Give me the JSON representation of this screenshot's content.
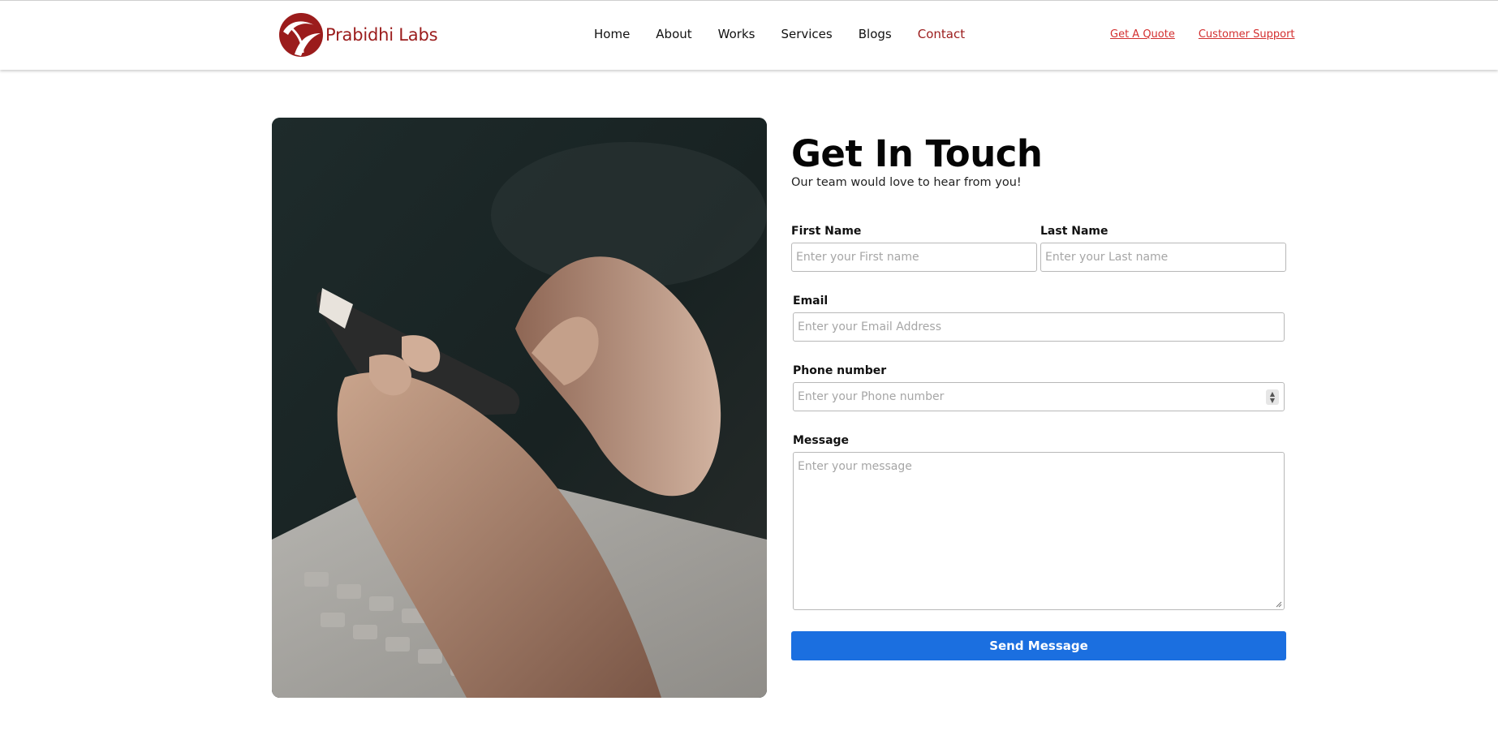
{
  "brand": {
    "name": "Prabidhi Labs",
    "color": "#9b1c1c"
  },
  "nav": {
    "items": [
      {
        "label": "Home",
        "active": false
      },
      {
        "label": "About",
        "active": false
      },
      {
        "label": "Works",
        "active": false
      },
      {
        "label": "Services",
        "active": false
      },
      {
        "label": "Blogs",
        "active": false
      },
      {
        "label": "Contact",
        "active": true
      }
    ]
  },
  "top_links": {
    "quote": "Get A Quote",
    "support": "Customer Support"
  },
  "contact": {
    "title": "Get In Touch",
    "subtitle": "Our team would love to hear from you!",
    "first_name": {
      "label": "First Name",
      "placeholder": "Enter your First name"
    },
    "last_name": {
      "label": "Last Name",
      "placeholder": "Enter your Last name"
    },
    "email": {
      "label": "Email",
      "placeholder": "Enter your Email Address"
    },
    "phone": {
      "label": "Phone number",
      "placeholder": "Enter your Phone number"
    },
    "message": {
      "label": "Message",
      "placeholder": "Enter your message"
    },
    "submit_label": "Send Message",
    "button_color": "#1b6fe0"
  },
  "image": {
    "subject": "hands-holding-smartphone-photo"
  }
}
